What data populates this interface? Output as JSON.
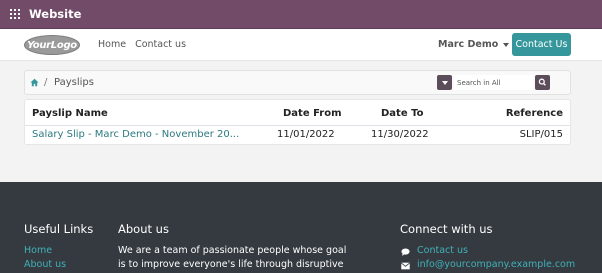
{
  "topbar": {
    "title": "Website",
    "apps_icon": "grid-icon"
  },
  "header": {
    "logo_text": "YourLogo",
    "nav": [
      {
        "label": "Home"
      },
      {
        "label": "Contact us"
      }
    ],
    "user": "Marc Demo",
    "contact_button": "Contact Us"
  },
  "breadcrumb": {
    "home_icon": "home-icon",
    "separator": "/",
    "current": "Payslips"
  },
  "search": {
    "placeholder": "Search in All",
    "icon": "search-icon"
  },
  "table": {
    "headers": [
      "Payslip Name",
      "Date From",
      "Date To",
      "Reference"
    ],
    "rows": [
      {
        "name": "Salary Slip - Marc Demo - November 20...",
        "date_from": "11/01/2022",
        "date_to": "11/30/2022",
        "reference": "SLIP/015"
      }
    ]
  },
  "footer": {
    "useful_links": {
      "heading": "Useful Links",
      "links": [
        "Home",
        "About us"
      ]
    },
    "about": {
      "heading": "About us",
      "text": "We are a team of passionate people whose goal is to improve everyone's life through disruptive"
    },
    "connect": {
      "heading": "Connect with us",
      "items": [
        {
          "icon": "chat-icon",
          "label": "Contact us"
        },
        {
          "icon": "envelope-icon",
          "label": "info@yourcompany.example.com"
        }
      ]
    }
  },
  "colors": {
    "topbar": "#714b67",
    "primary": "#35979c",
    "footer": "#343a40",
    "link": "#2b7a80"
  }
}
